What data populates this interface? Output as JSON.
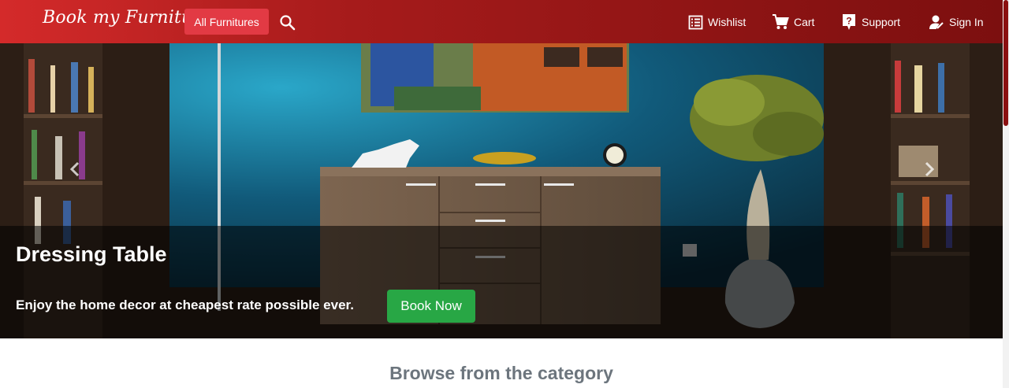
{
  "header": {
    "brand": "Book my Furniture",
    "all_furnitures_label": "All Furnitures",
    "nav": {
      "wishlist": "Wishlist",
      "cart": "Cart",
      "support": "Support",
      "sign_in": "Sign In"
    },
    "icons": [
      "search-icon",
      "list-icon",
      "cart-icon",
      "help-icon",
      "user-icon"
    ],
    "colors": {
      "gradient_start": "#d42a2a",
      "gradient_end": "#7c0f0f",
      "all_button": "#e23a44"
    }
  },
  "hero": {
    "slide_title": "Dressing Table",
    "slide_text": "Enjoy the home decor at cheapest rate possible ever.",
    "cta_label": "Book Now",
    "cta_color": "#28a745",
    "prev_icon": "chevron-left-icon",
    "next_icon": "chevron-right-icon"
  },
  "browse": {
    "title": "Browse from the category"
  }
}
